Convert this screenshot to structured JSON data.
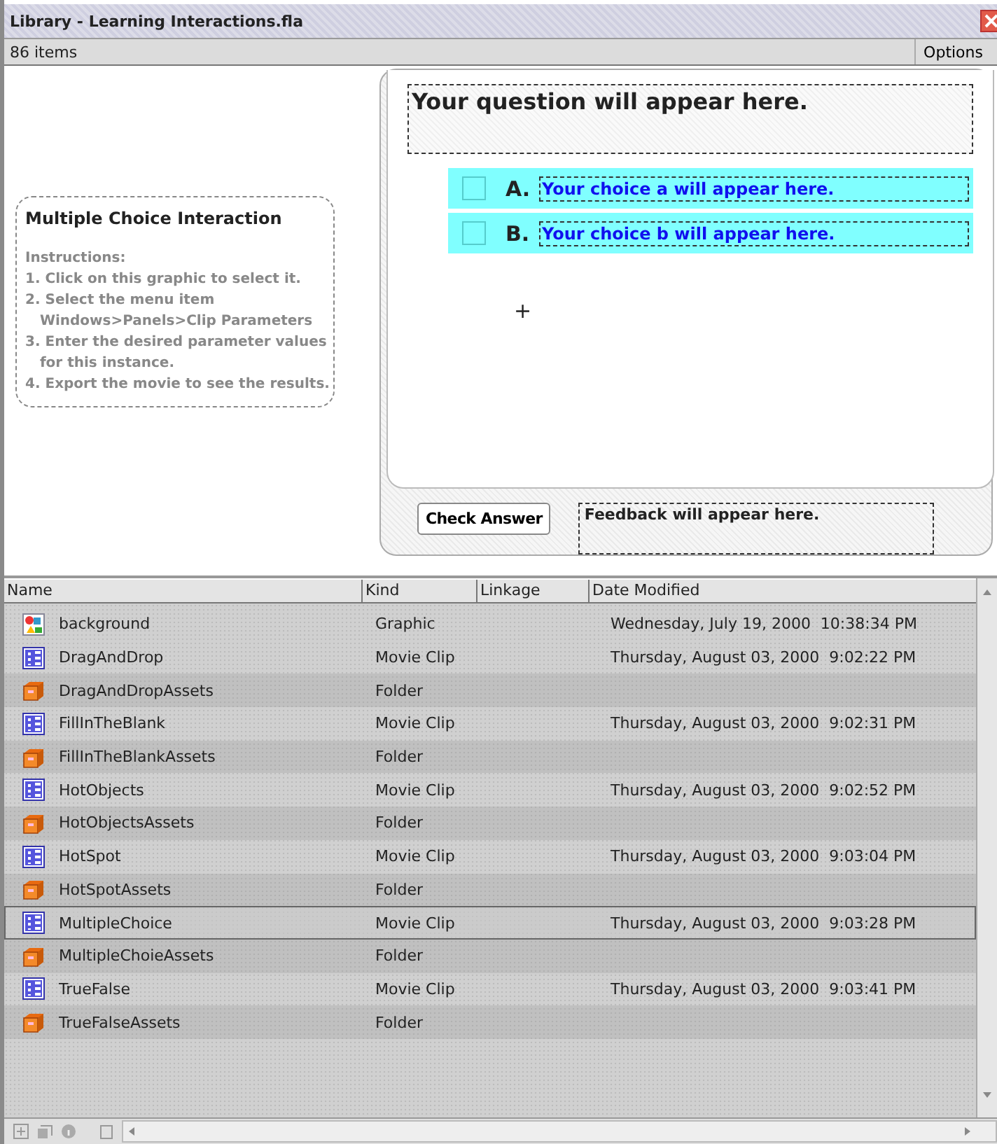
{
  "window": {
    "title": "Library - Learning Interactions.fla"
  },
  "header": {
    "count": "86 items",
    "options": "Options"
  },
  "preview": {
    "instructions_title": "Multiple Choice Interaction",
    "instructions": [
      "Instructions:",
      "1. Click on this graphic to select it.",
      "2. Select the menu item",
      "   Windows>Panels>Clip Parameters",
      "3. Enter the desired parameter values",
      "   for this instance.",
      "4. Export the movie to see the results."
    ],
    "question": "Your question will appear here.",
    "choices": [
      {
        "letter": "A.",
        "text": "Your choice a will appear here.",
        "checked": false
      },
      {
        "letter": "B.",
        "text": "Your choice b will appear here.",
        "checked": false
      }
    ],
    "crosshair": "+",
    "check_button": "Check Answer",
    "feedback": "Feedback will appear here."
  },
  "table": {
    "columns": [
      "Name",
      "Kind",
      "Linkage",
      "Date Modified"
    ],
    "rows": [
      {
        "name": "background",
        "kind": "graphic",
        "type": "Graphic",
        "date": "Wednesday, July 19, 2000  10:38:34 PM",
        "selected": false
      },
      {
        "name": "DragAndDrop",
        "kind": "clip",
        "type": "Movie Clip",
        "date": "Thursday, August 03, 2000  9:02:22 PM",
        "selected": false
      },
      {
        "name": "DragAndDropAssets",
        "kind": "folder",
        "type": "Folder",
        "selected": false
      },
      {
        "name": "FillInTheBlank",
        "kind": "clip",
        "type": "Movie Clip",
        "date": "Thursday, August 03, 2000  9:02:31 PM",
        "selected": false
      },
      {
        "name": "FillInTheBlankAssets",
        "kind": "folder",
        "type": "Folder",
        "selected": false
      },
      {
        "name": "HotObjects",
        "kind": "clip",
        "type": "Movie Clip",
        "date": "Thursday, August 03, 2000  9:02:52 PM",
        "selected": false
      },
      {
        "name": "HotObjectsAssets",
        "kind": "folder",
        "type": "Folder",
        "selected": false
      },
      {
        "name": "HotSpot",
        "kind": "clip",
        "type": "Movie Clip",
        "date": "Thursday, August 03, 2000  9:03:04 PM",
        "selected": false
      },
      {
        "name": "HotSpotAssets",
        "kind": "folder",
        "type": "Folder",
        "selected": false
      },
      {
        "name": "MultipleChoice",
        "kind": "clip",
        "type": "Movie Clip",
        "date": "Thursday, August 03, 2000  9:03:28 PM",
        "selected": true
      },
      {
        "name": "MultipleChoieAssets",
        "kind": "folder",
        "type": "Folder",
        "selected": false
      },
      {
        "name": "TrueFalse",
        "kind": "clip",
        "type": "Movie Clip",
        "date": "Thursday, August 03, 2000  9:03:41 PM",
        "selected": false
      },
      {
        "name": "TrueFalseAssets",
        "kind": "folder",
        "type": "Folder",
        "selected": false
      }
    ]
  }
}
